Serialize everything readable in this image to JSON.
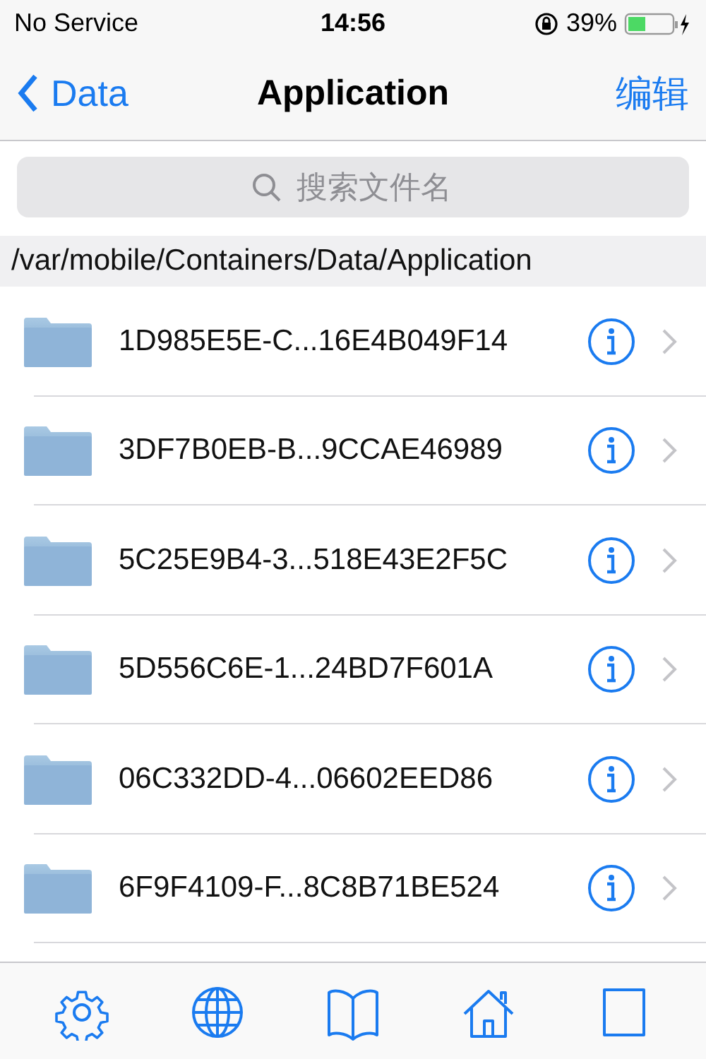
{
  "status_bar": {
    "carrier": "No Service",
    "time": "14:56",
    "battery": "39%"
  },
  "nav": {
    "back": "Data",
    "title": "Application",
    "action": "编辑"
  },
  "search": {
    "placeholder": "搜索文件名"
  },
  "path": "/var/mobile/Containers/Data/Application",
  "rows": [
    {
      "name": "1D985E5E-C...16E4B049F14"
    },
    {
      "name": "3DF7B0EB-B...9CCAE46989"
    },
    {
      "name": "5C25E9B4-3...518E43E2F5C"
    },
    {
      "name": "5D556C6E-1...24BD7F601A"
    },
    {
      "name": "06C332DD-4...06602EED86"
    },
    {
      "name": "6F9F4109-F...8C8B71BE524"
    }
  ],
  "tab_bar": [
    {
      "kind": "settings"
    },
    {
      "kind": "globe"
    },
    {
      "kind": "book"
    },
    {
      "kind": "home"
    },
    {
      "kind": "window"
    }
  ]
}
